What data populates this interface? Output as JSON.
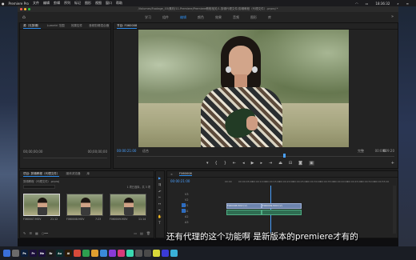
{
  "mac_menu": {
    "app": "Premiere Pro",
    "items": [
      "文件",
      "编辑",
      "剪辑",
      "序列",
      "标记",
      "图形",
      "视图",
      "窗口",
      "帮助"
    ],
    "clock": "18:36:32"
  },
  "window_title": "/Volumes/Footage_03/素材/11.Premiere/Premiere教程相关/1.剪辑代理文件/剪辑教程（代理文件）.prproj *",
  "workspaces": {
    "items": [
      "学习",
      "组件",
      "编辑",
      "颜色",
      "效果",
      "音频",
      "图形",
      "库"
    ],
    "active": "编辑"
  },
  "source_panel": {
    "tabs": [
      "源（无剪辑）",
      "Lumetri 范围",
      "效果控件",
      "音频剪辑混合器"
    ],
    "timecode_left": "00;00;00;00",
    "timecode_right": "00;00;00;00"
  },
  "program_panel": {
    "tab": "节目: F060008",
    "timecode_current": "00:00:21:00",
    "fit_label": "适合",
    "quality_label": "完整",
    "timecode_duration": "00:00:29:20"
  },
  "project_panel": {
    "tabs": [
      "项目: 剪辑教程（代理文件）",
      "媒体浏览器",
      "库"
    ],
    "file_name": "剪辑教程（代理文件）.prproj",
    "count_label": "1 项已选择，共 3 项",
    "thumbnails": [
      {
        "name": "F060007.MOV",
        "duration": "21:12"
      },
      {
        "name": "F060008.MOV",
        "duration": "7:23"
      },
      {
        "name": "F060009.MOV",
        "duration": "11:14"
      }
    ]
  },
  "timeline_panel": {
    "tab": "F060008",
    "timecode": "00:00:21:00",
    "ruler": [
      "00:00",
      "00:00:05:00",
      "00:00:10:00",
      "00:00:15:00",
      "00:00:20:00",
      "00:00:25:00",
      "00:00:30:00",
      "00:00:35:00",
      "00:00:40:00",
      "00:00:45:00",
      "00:00:50:00",
      "00:00:55:00"
    ],
    "tracks": [
      "V3",
      "V2",
      "V1",
      "A1",
      "A2",
      "A3"
    ],
    "clip_v1_name": "F060008.MOV [V]",
    "clip_v2_name": "F060009.MOV [V]"
  },
  "subtitle": "还有代理的这个功能啊 是新版本的premiere才有的",
  "dock_icons": [
    {
      "label": "",
      "color": "#3a6fd8"
    },
    {
      "label": "",
      "color": "#6b6b6b"
    },
    {
      "label": "Ps",
      "color": "#0c1e3a"
    },
    {
      "label": "Pr",
      "color": "#1b0e3a"
    },
    {
      "label": "Me",
      "color": "#1b0e3a"
    },
    {
      "label": "Br",
      "color": "#1b1b1b"
    },
    {
      "label": "Au",
      "color": "#0a2b2a"
    },
    {
      "label": "Ai",
      "color": "#2b1a05"
    },
    {
      "label": "",
      "color": "#d64a3a"
    },
    {
      "label": "",
      "color": "#2d9e4f"
    },
    {
      "label": "",
      "color": "#e0a030"
    },
    {
      "label": "",
      "color": "#3a8ad8"
    },
    {
      "label": "",
      "color": "#8a3ad8"
    },
    {
      "label": "",
      "color": "#d83a7a"
    },
    {
      "label": "",
      "color": "#3ad8b0"
    },
    {
      "label": "",
      "color": "#555555"
    },
    {
      "label": "",
      "color": "#4a4a4a"
    },
    {
      "label": "",
      "color": "#d8d83a"
    },
    {
      "label": "",
      "color": "#3a3ad8"
    },
    {
      "label": "",
      "color": "#3ab0d8"
    }
  ]
}
